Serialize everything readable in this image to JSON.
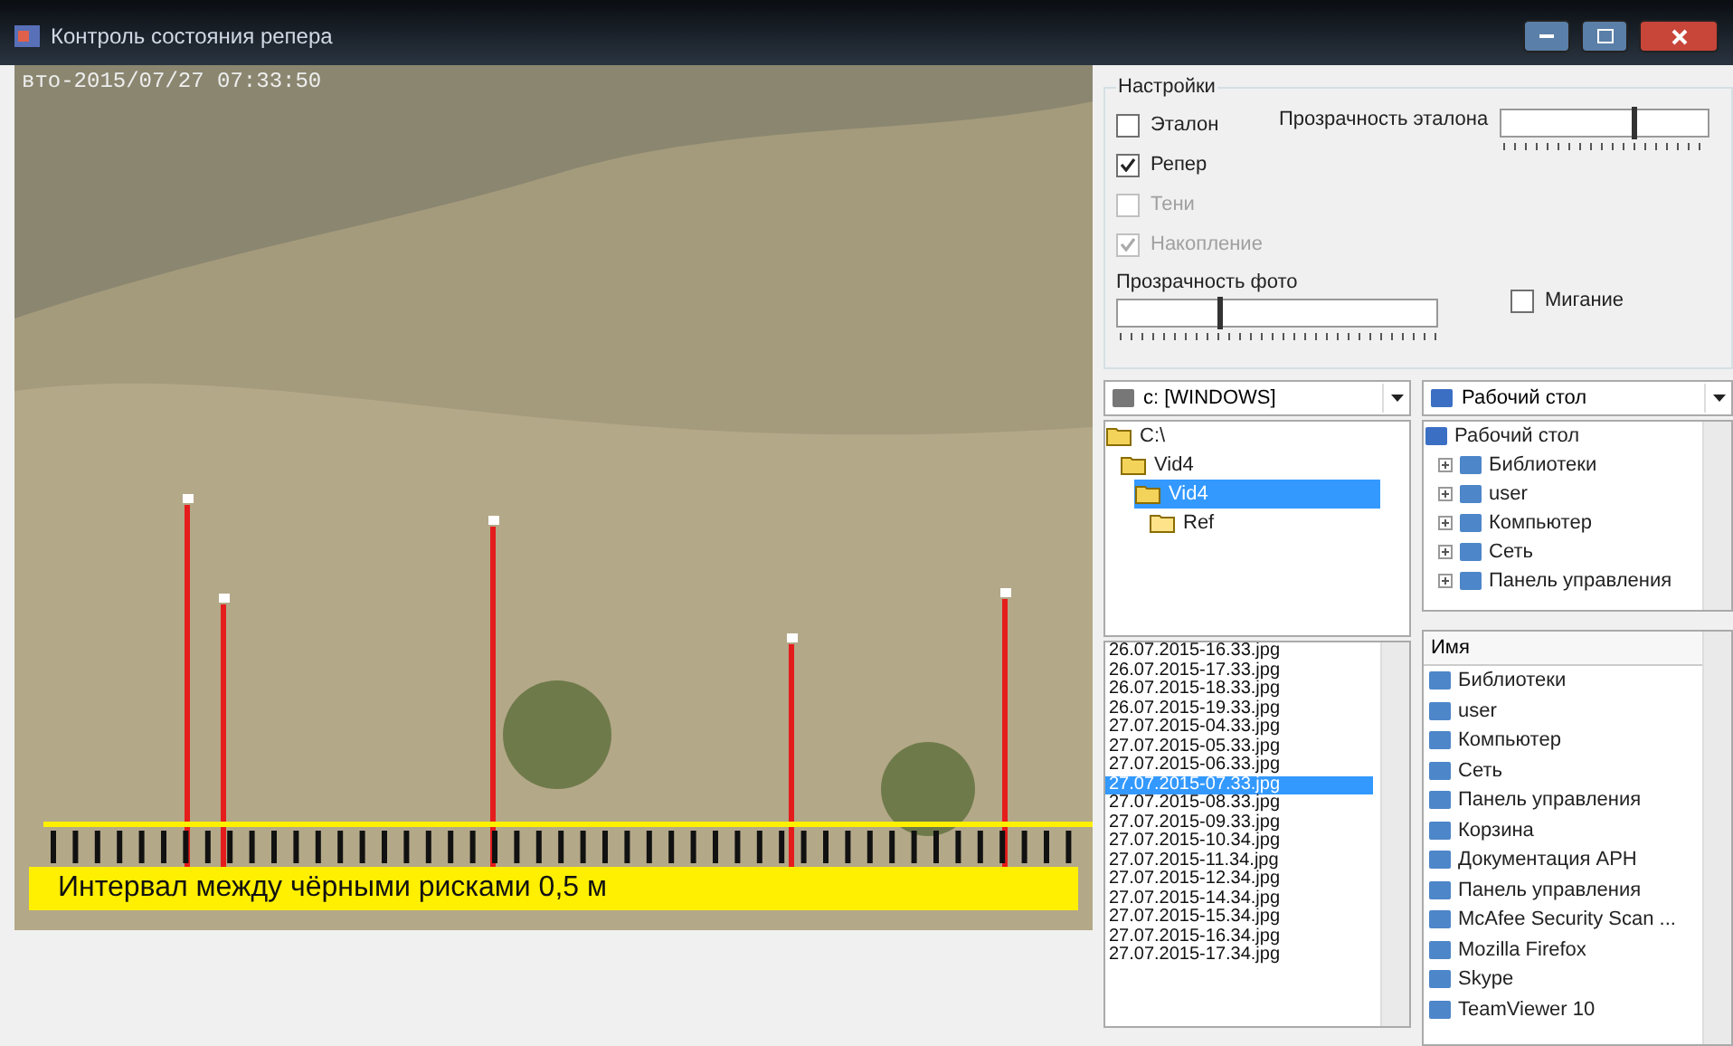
{
  "window": {
    "title": "Контроль состояния репера"
  },
  "photo": {
    "timestamp": "вто-2015/07/27 07:33:50",
    "caption": "Интервал между чёрными рисками 0,5 м"
  },
  "settings": {
    "title": "Настройки",
    "checkboxes": [
      {
        "label": "Эталон",
        "checked": false,
        "disabled": false
      },
      {
        "label": "Репер",
        "checked": true,
        "disabled": false
      },
      {
        "label": "Тени",
        "checked": false,
        "disabled": true
      },
      {
        "label": "Накопление",
        "checked": true,
        "disabled": true
      }
    ],
    "reference_opacity": {
      "label": "Прозрачность эталона",
      "level": 0.64
    },
    "photo_opacity": {
      "label": "Прозрачность фото",
      "level": 0.32
    },
    "blink": {
      "label": "Мигание",
      "checked": false
    }
  },
  "drive_combo": {
    "value": "c: [WINDOWS]"
  },
  "folders": [
    {
      "label": "C:\\",
      "selected": false,
      "children": [
        {
          "label": "Vid4",
          "selected": false,
          "children": [
            {
              "label": "Vid4",
              "selected": true,
              "children": [
                {
                  "label": "Ref",
                  "selected": false
                }
              ]
            }
          ]
        }
      ]
    }
  ],
  "files": [
    {
      "name": "26.07.2015-16.33.jpg",
      "selected": false
    },
    {
      "name": "26.07.2015-17.33.jpg",
      "selected": false
    },
    {
      "name": "26.07.2015-18.33.jpg",
      "selected": false
    },
    {
      "name": "26.07.2015-19.33.jpg",
      "selected": false
    },
    {
      "name": "27.07.2015-04.33.jpg",
      "selected": false
    },
    {
      "name": "27.07.2015-05.33.jpg",
      "selected": false
    },
    {
      "name": "27.07.2015-06.33.jpg",
      "selected": false
    },
    {
      "name": "27.07.2015-07.33.jpg",
      "selected": true
    },
    {
      "name": "27.07.2015-08.33.jpg",
      "selected": false
    },
    {
      "name": "27.07.2015-09.33.jpg",
      "selected": false
    },
    {
      "name": "27.07.2015-10.34.jpg",
      "selected": false
    },
    {
      "name": "27.07.2015-11.34.jpg",
      "selected": false
    },
    {
      "name": "27.07.2015-12.34.jpg",
      "selected": false
    },
    {
      "name": "27.07.2015-14.34.jpg",
      "selected": false
    },
    {
      "name": "27.07.2015-15.34.jpg",
      "selected": false
    },
    {
      "name": "27.07.2015-16.34.jpg",
      "selected": false
    },
    {
      "name": "27.07.2015-17.34.jpg",
      "selected": false
    }
  ],
  "shell_combo": {
    "value": "Рабочий стол"
  },
  "shell_tree": {
    "root": "Рабочий стол",
    "items": [
      "Библиотеки",
      "user",
      "Компьютер",
      "Сеть",
      "Панель управления"
    ]
  },
  "shell_list": {
    "column": "Имя",
    "items": [
      "Библиотеки",
      "user",
      "Компьютер",
      "Сеть",
      "Панель управления",
      "Корзина",
      "Документация АРН",
      "Панель управления",
      "McAfee Security Scan ...",
      "Mozilla Firefox",
      "Skype",
      "TeamViewer 10"
    ]
  }
}
